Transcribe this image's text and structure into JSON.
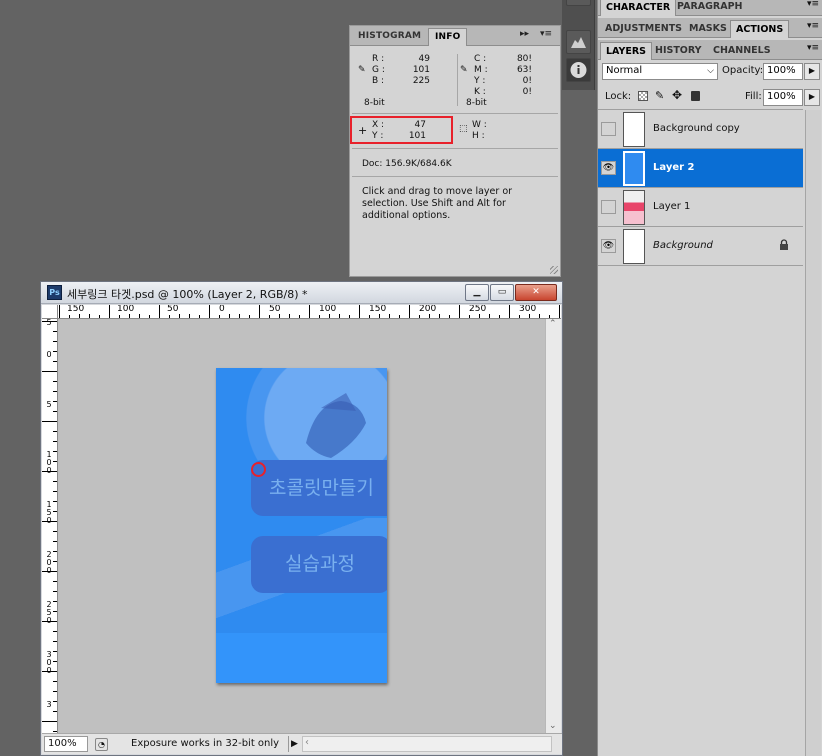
{
  "info_panel": {
    "tabs": [
      "HISTOGRAM",
      "INFO"
    ],
    "active_tab": "INFO",
    "menu_glyph": "▸▸",
    "rgb": {
      "r_label": "R :",
      "r": "49",
      "g_label": "G :",
      "g": "101",
      "b_label": "B :",
      "b": "225",
      "bitdepth": "8-bit"
    },
    "cmyk": {
      "c_label": "C :",
      "c": "80!",
      "m_label": "M :",
      "m": "63!",
      "y_label": "Y :",
      "y": "0!",
      "k_label": "K :",
      "k": "0!",
      "bitdepth": "8-bit"
    },
    "position": {
      "x_label": "X :",
      "x": "47",
      "y_label": "Y :",
      "y": "101"
    },
    "size": {
      "w_label": "W :",
      "h_label": "H :"
    },
    "doc_size": "Doc: 156.9K/684.6K",
    "hint": "Click and drag to move layer or selection.  Use Shift and Alt for additional options."
  },
  "right_panels": {
    "top_tabs": [
      "CHARACTER",
      "PARAGRAPH"
    ],
    "mid_tabs": [
      "ADJUSTMENTS",
      "MASKS",
      "ACTIONS"
    ],
    "mid_active": "ACTIONS",
    "layer_tabs": [
      "LAYERS",
      "HISTORY",
      "CHANNELS"
    ],
    "layer_active": "LAYERS",
    "blend_mode": "Normal",
    "opacity_label": "Opacity:",
    "opacity": "100%",
    "lock_label": "Lock:",
    "fill_label": "Fill:",
    "fill": "100%",
    "layers": [
      {
        "name": "Background copy",
        "visible": false,
        "selected": false,
        "italic": false,
        "locked": false
      },
      {
        "name": "Layer 2",
        "visible": true,
        "selected": true,
        "italic": false,
        "locked": false
      },
      {
        "name": "Layer 1",
        "visible": false,
        "selected": false,
        "italic": false,
        "locked": false
      },
      {
        "name": "Background",
        "visible": true,
        "selected": false,
        "italic": true,
        "locked": true
      }
    ]
  },
  "document": {
    "title": "세부링크 타겟.psd @ 100% (Layer 2, RGB/8) *",
    "ps_icon": "Ps",
    "zoom": "100%",
    "status_text": "Exposure works in 32-bit only",
    "h_ruler_labels": [
      "150",
      "100",
      "50",
      "0",
      "50",
      "100",
      "150",
      "200",
      "250",
      "300"
    ],
    "v_ruler_labels": [
      "5",
      "0",
      "5",
      "100",
      "150",
      "200",
      "250",
      "300",
      "3"
    ],
    "art": {
      "button1_text": "초콜릿만들기",
      "button2_text": "실습과정"
    }
  },
  "colors": {
    "selected_layer": "#0a6ed4",
    "highlight_box": "#e8212b",
    "art_blue": "#2f8bf0"
  }
}
